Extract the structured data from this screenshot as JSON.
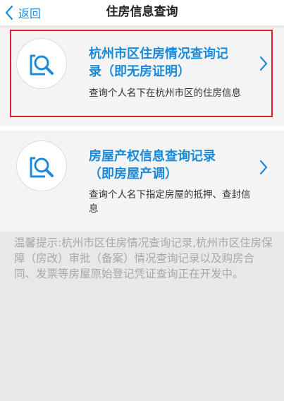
{
  "navbar": {
    "back_label": "返回",
    "title": "住房信息查询"
  },
  "options": [
    {
      "title_line1": "杭州市区住房情况查询记",
      "title_line2": "录（即无房证明）",
      "description": "查询个人名下在杭州市区的住房信息",
      "icon": "search-document-icon",
      "highlighted": true
    },
    {
      "title_line1": "房屋产权信息查询记录",
      "title_line2": "（即房屋产调）",
      "description": "查询个人名下指定房屋的抵押、查封信息",
      "icon": "search-document-icon",
      "highlighted": false
    }
  ],
  "tip": "温馨提示:杭州市区住房情况查询记录,杭州市区住房保障（房改）审批（备案）情况查询记录以及购房合同、发票等房屋原始登记凭证查询正在开发中。",
  "colors": {
    "accent": "#1c8bdc",
    "highlight_border": "#d8232a",
    "tip_text": "#a8a8a8"
  }
}
